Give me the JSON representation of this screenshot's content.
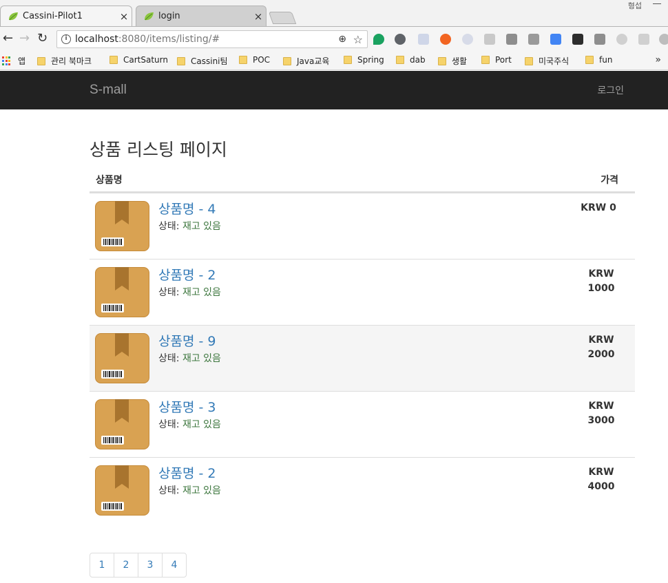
{
  "browser": {
    "tabs": [
      {
        "title": "Cassini-Pilot1",
        "close": "×"
      },
      {
        "title": "login",
        "close": "×"
      }
    ],
    "window_user": "형섭",
    "nav": {
      "back": "←",
      "forward": "→",
      "reload": "↻"
    },
    "url": {
      "host": "localhost",
      "rest": ":8080/items/listing/#"
    },
    "zoom_icon": "⊕",
    "star_icon": "☆",
    "bookmarks": [
      "앱",
      "관리 북마크",
      "CartSaturn",
      "Cassini팀",
      "POC",
      "Java교육",
      "Spring",
      "dab",
      "생활",
      "Port",
      "미국주식",
      "fun"
    ],
    "bookmarks_more": "»"
  },
  "site": {
    "brand": "S-mall",
    "login": "로그인"
  },
  "page": {
    "title": "상품 리스팅 페이지",
    "columns": {
      "name": "상품명",
      "price": "가격"
    },
    "items": [
      {
        "name": "상품명 - 4",
        "status_label": "상태:",
        "status": "재고 있음",
        "price_line1": "KRW 0",
        "price_line2": ""
      },
      {
        "name": "상품명 - 2",
        "status_label": "상태:",
        "status": "재고 있음",
        "price_line1": "KRW",
        "price_line2": "1000"
      },
      {
        "name": "상품명 - 9",
        "status_label": "상태:",
        "status": "재고 있음",
        "price_line1": "KRW",
        "price_line2": "2000"
      },
      {
        "name": "상품명 - 3",
        "status_label": "상태:",
        "status": "재고 있음",
        "price_line1": "KRW",
        "price_line2": "3000"
      },
      {
        "name": "상품명 - 2",
        "status_label": "상태:",
        "status": "재고 있음",
        "price_line1": "KRW",
        "price_line2": "4000"
      }
    ],
    "pagination": [
      "1",
      "2",
      "3",
      "4"
    ]
  },
  "colors": {
    "navbar_bg": "#222222",
    "link": "#337ab7",
    "in_stock": "#3c763d",
    "box": "#d9a252"
  }
}
